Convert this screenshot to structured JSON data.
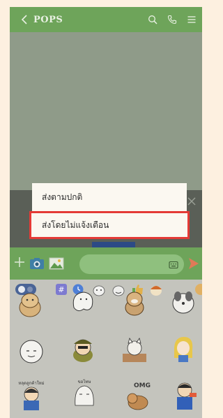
{
  "header": {
    "title": "POPS",
    "icons": [
      "back-chevron-icon",
      "search-icon",
      "phone-icon",
      "menu-icon"
    ]
  },
  "send_menu": {
    "items": [
      {
        "label": "ส่งตามปกติ",
        "highlighted": false
      },
      {
        "label": "ส่งโดยไม่แจ้งเตือน",
        "highlighted": true
      }
    ],
    "highlight_color": "#e43a36"
  },
  "input_bar": {
    "icons": [
      "plus-icon",
      "camera-icon",
      "image-icon",
      "keyboard-icon",
      "send-icon"
    ]
  },
  "sticker_tray": {
    "tabs": [
      "emoji-toggle-icon",
      "hashtag-icon",
      "clock-icon",
      "sticker-cat-tab",
      "sticker-cat-tab",
      "thumbs-up-tab",
      "hair-bear-tab"
    ],
    "stickers": [
      {
        "name": "bear-sitting",
        "caption": ""
      },
      {
        "name": "ghost-floating",
        "caption": ""
      },
      {
        "name": "dog-shy",
        "caption": ""
      },
      {
        "name": "dog-grey",
        "caption": ""
      },
      {
        "name": "round-face",
        "caption": ""
      },
      {
        "name": "soldier-green",
        "caption": ""
      },
      {
        "name": "cat-desk",
        "caption": ""
      },
      {
        "name": "girl-yellow",
        "caption": ""
      },
      {
        "name": "crying-kid",
        "caption": "หลุดลูกค้าใหม่"
      },
      {
        "name": "bowing-person",
        "caption": "ขอโทษ"
      },
      {
        "name": "omg-dog",
        "caption": "OMG"
      },
      {
        "name": "wave-man",
        "caption": ""
      }
    ]
  },
  "colors": {
    "page_bg": "#fdf0e0",
    "header_green": "#6ea45a",
    "chat_bg": "#8f9b89",
    "tray_bg": "#c4c4bd"
  }
}
